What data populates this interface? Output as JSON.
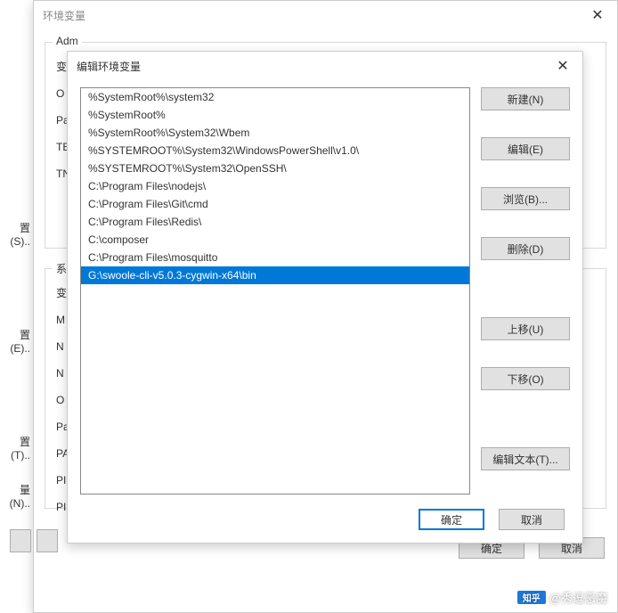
{
  "back_dialog": {
    "title": "环境变量",
    "user_vars_label": "Adm",
    "system_vars_label": "系统",
    "stub_settings_s": "置(S)..",
    "stub_settings_e": "置(E)..",
    "stub_settings_t": "置(T)..",
    "stub_amount_n": "量(N)..",
    "user_rows": [
      "变",
      "O",
      "Pa",
      "TE",
      "TN"
    ],
    "system_rows": [
      "变",
      "M",
      "N",
      "N",
      "O",
      "Pa",
      "PA",
      "PI",
      "PI"
    ],
    "ok": "确定",
    "cancel": "取消"
  },
  "mid_dialog": {
    "title": "编辑环境变量",
    "entries": [
      "%SystemRoot%\\system32",
      "%SystemRoot%",
      "%SystemRoot%\\System32\\Wbem",
      "%SYSTEMROOT%\\System32\\WindowsPowerShell\\v1.0\\",
      "%SYSTEMROOT%\\System32\\OpenSSH\\",
      "C:\\Program Files\\nodejs\\",
      "C:\\Program Files\\Git\\cmd",
      "C:\\Program Files\\Redis\\",
      "C:\\composer",
      "C:\\Program Files\\mosquitto",
      "G:\\swoole-cli-v5.0.3-cygwin-x64\\bin"
    ],
    "selected_index": 10,
    "buttons": {
      "new": "新建(N)",
      "edit": "编辑(E)",
      "browse": "浏览(B)...",
      "delete": "删除(D)",
      "move_up": "上移(U)",
      "move_down": "下移(O)",
      "edit_text": "编辑文本(T)..."
    },
    "ok": "确定",
    "cancel": "取消"
  },
  "watermark": {
    "logo": "知乎",
    "text": "@秀逗恶魔"
  }
}
